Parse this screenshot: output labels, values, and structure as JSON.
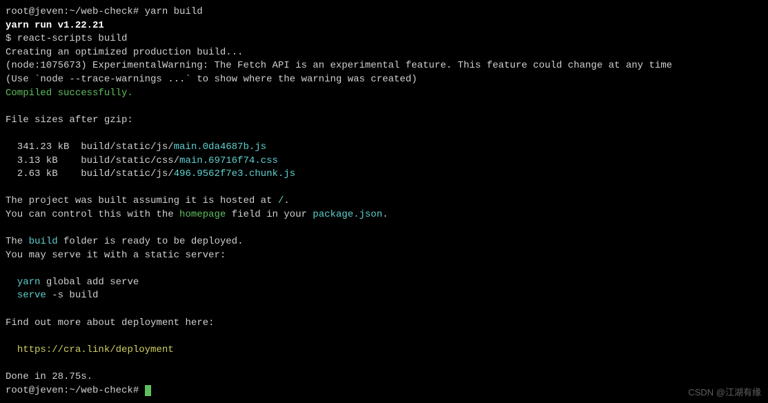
{
  "terminal": {
    "prompt1_user": "root@jeven",
    "prompt1_sep": ":",
    "prompt1_path": "~/web-check#",
    "command1": " yarn build",
    "yarn_version": "yarn run v1.22.21",
    "dollar_line": "$ react-scripts build",
    "creating": "Creating an optimized production build...",
    "node_warning_1": "(node:1075673) ExperimentalWarning: The Fetch API is an experimental feature. This feature could change at any time",
    "node_warning_2": "(Use `node --trace-warnings ...` to show where the warning was created)",
    "compiled": "Compiled successfully.",
    "file_sizes_label": "File sizes after gzip:",
    "file1_size": "  341.23 kB  ",
    "file1_path": "build/static/js/",
    "file1_name": "main.0da4687b.js",
    "file2_size": "  3.13 kB    ",
    "file2_path": "build/static/css/",
    "file2_name": "main.69716f74.css",
    "file3_size": "  2.63 kB    ",
    "file3_path": "build/static/js/",
    "file3_name": "496.9562f7e3.chunk.js",
    "hosted_1": "The project was built assuming it is hosted at ",
    "hosted_slash": "/",
    "hosted_2": ".",
    "control_1": "You can control this with the ",
    "control_homepage": "homepage",
    "control_2": " field in your ",
    "control_pkg": "package.json",
    "control_3": ".",
    "build_1": "The ",
    "build_word": "build",
    "build_2": " folder is ready to be deployed.",
    "serve_label": "You may serve it with a static server:",
    "yarn_cmd_1": "  ",
    "yarn_cmd_word": "yarn",
    "yarn_cmd_2": " global add serve",
    "serve_cmd_1": "  ",
    "serve_cmd_word": "serve",
    "serve_cmd_2": " -s build",
    "find_out": "Find out more about deployment here:",
    "deploy_link_1": "  ",
    "deploy_link": "https://cra.link/deployment",
    "done_in": "Done in 28.75s.",
    "prompt2_user": "root@jeven",
    "prompt2_sep": ":",
    "prompt2_path": "~/web-check#",
    "prompt2_space": " "
  },
  "watermark": "CSDN @江湖有缘"
}
